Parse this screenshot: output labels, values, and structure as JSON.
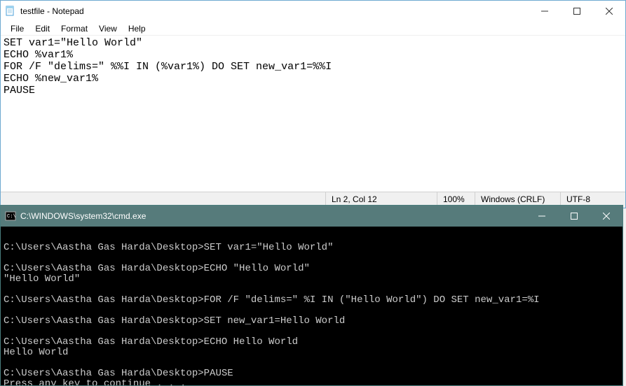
{
  "notepad": {
    "title": "testfile - Notepad",
    "menu": {
      "file": "File",
      "edit": "Edit",
      "format": "Format",
      "view": "View",
      "help": "Help"
    },
    "content": "SET var1=\"Hello World\"\nECHO %var1%\nFOR /F \"delims=\" %%I IN (%var1%) DO SET new_var1=%%I\nECHO %new_var1%\nPAUSE",
    "status": {
      "position": "Ln 2, Col 12",
      "zoom": "100%",
      "lineend": "Windows (CRLF)",
      "encoding": "UTF-8"
    }
  },
  "cmd": {
    "title": "C:\\WINDOWS\\system32\\cmd.exe",
    "output": "\nC:\\Users\\Aastha Gas Harda\\Desktop>SET var1=\"Hello World\"\n\nC:\\Users\\Aastha Gas Harda\\Desktop>ECHO \"Hello World\"\n\"Hello World\"\n\nC:\\Users\\Aastha Gas Harda\\Desktop>FOR /F \"delims=\" %I IN (\"Hello World\") DO SET new_var1=%I\n\nC:\\Users\\Aastha Gas Harda\\Desktop>SET new_var1=Hello World\n\nC:\\Users\\Aastha Gas Harda\\Desktop>ECHO Hello World\nHello World\n\nC:\\Users\\Aastha Gas Harda\\Desktop>PAUSE\nPress any key to continue . . . "
  }
}
